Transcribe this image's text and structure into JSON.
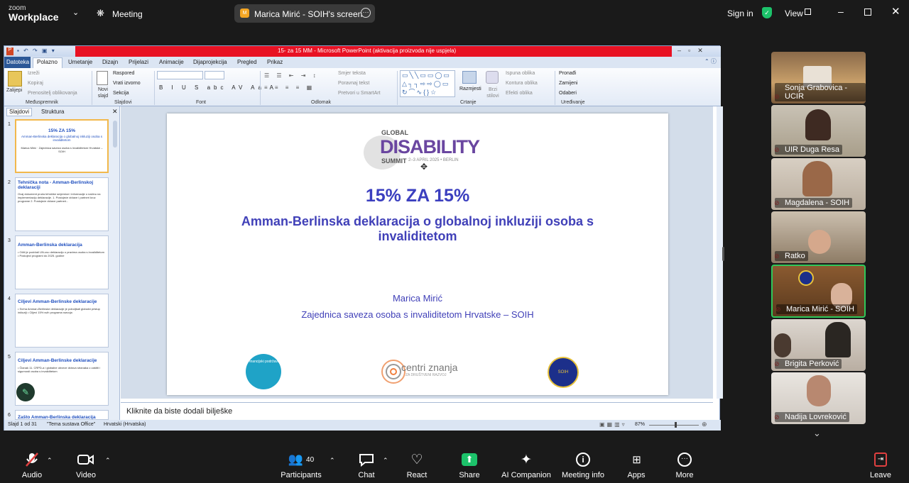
{
  "zoom": {
    "brand_small": "zoom",
    "brand": "Workplace",
    "meeting": "Meeting",
    "share_title": "Marica Mirić - SOIH's screen",
    "signin": "Sign in",
    "view": "View"
  },
  "ppt": {
    "title": "15- za 15 MM  -  Microsoft PowerPoint (aktivacija proizvoda nije uspjela)",
    "tabs": [
      "Datoteka",
      "Polazno",
      "Umetanje",
      "Dizajn",
      "Prijelazi",
      "Animacije",
      "Dijaprojekcija",
      "Pregled",
      "Prikaz"
    ],
    "ribbon": {
      "paste": "Zalijepi",
      "cut": "Izreži",
      "copy": "Kopiraj",
      "format_painter": "Prenositelj oblikovanja",
      "clipboard": "Međuspremnik",
      "new_slide": "Novi slajd",
      "layout": "Raspored",
      "reset": "Vrati izvorno",
      "section": "Sekcija",
      "slides": "Slajdovi",
      "font": "Font",
      "paragraph": "Odlomak",
      "text_dir": "Smjer teksta",
      "align_text": "Poravnaj tekst",
      "smartart": "Pretvori u SmartArt",
      "arrange": "Razmjesti",
      "quick_styles": "Brzi stilovi",
      "fill": "Ispuna oblika",
      "outline": "Kontura oblika",
      "effects": "Efekti oblika",
      "drawing": "Crtanje",
      "find": "Pronađi",
      "replace": "Zamijeni",
      "select": "Odaberi",
      "editing": "Uređivanje"
    },
    "panel_tabs": [
      "Slajdovi",
      "Struktura"
    ],
    "thumbs": [
      {
        "num": "1",
        "title": "15% ZA 15%",
        "sub": "Amman-Berlinska deklaracija o globalnoj inkluziji osoba s invaliditetom",
        "body": "Marica Mirić · Zajednica saveza osoba s invaliditetom Hrvatske – SOIH"
      },
      {
        "num": "2",
        "title": "Tehnička nota - Amman-Berlinskoj deklaraciji",
        "sub": "",
        "body": "Ovaj dokument pruža tehničke smjernice i informacije o načinu na implementaciju deklaracije. 1. Postojeće države i partneri kroz programe 2. Postojeće države partneri..."
      },
      {
        "num": "3",
        "title": "Amman-Berlinska deklaracija",
        "sub": "",
        "body": "• Očiti je podržali UN-ovu deklaraciju o pravima osoba s invaliditetom • Postojeći programi do 2025. godine"
      },
      {
        "num": "4",
        "title": "Ciljevi Amman-Berlinske deklaracije",
        "sub": "",
        "body": "• Svrha Amman-Berlinske deklaracije je poboljšati globalni pristup inkluziji • Ciljevi 15% svih programa razvoja"
      },
      {
        "num": "5",
        "title": "Ciljevi Amman-Berlinske deklaracije",
        "sub": "",
        "body": "• Članak 11. CRPD-a i globalne obveze država stranaka o zaštiti i sigurnosti osoba s invaliditetom"
      },
      {
        "num": "6",
        "title": "Zašto Amman-Berlinska deklaracija",
        "sub": "",
        "body": ""
      }
    ],
    "slide": {
      "logo_top": "GLOBAL",
      "logo_main": "DISABILITY",
      "logo_bottom": "SUMMIT",
      "logo_date": "2–3 APRIL 2025 • BERLIN",
      "title": "15% ZA 15%",
      "subtitle_line1": "Amman-Berlinska deklaracija o globalnoj inkluziji osoba s",
      "subtitle_line2": "invaliditetom",
      "author": "Marica Mirić",
      "org": "Zajednica saveza osoba s invaliditetom Hrvatske – SOIH",
      "logo1": "Financijski podržava",
      "logo2_main": "centri znanja",
      "logo2_sub": "ZA DRUŠTVENI RAZVOJ",
      "logo3": "SOIH"
    },
    "notes": "Kliknite da biste dodali bilješke",
    "status": {
      "slide": "Slajd 1 od 31",
      "theme": "\"Tema sustava Office\"",
      "lang": "Hrvatski (Hrvatska)",
      "zoom": "87%"
    }
  },
  "participants": [
    {
      "name": "Sonja Grabovica - UCIR"
    },
    {
      "name": "UIR Duga Resa"
    },
    {
      "name": "Magdalena - SOIH"
    },
    {
      "name": "Ratko"
    },
    {
      "name": "Marica Mirić - SOIH"
    },
    {
      "name": "Brigita Perković"
    },
    {
      "name": "Nadija Lovreković"
    }
  ],
  "toolbar": {
    "audio": "Audio",
    "video": "Video",
    "participants": "Participants",
    "participants_count": "40",
    "chat": "Chat",
    "react": "React",
    "share": "Share",
    "ai": "AI Companion",
    "info": "Meeting info",
    "apps": "Apps",
    "more": "More",
    "leave": "Leave"
  },
  "colors": {
    "accent": "#1f4fbf",
    "share_green": "#1cc26a",
    "active_border": "#2ec85a"
  }
}
